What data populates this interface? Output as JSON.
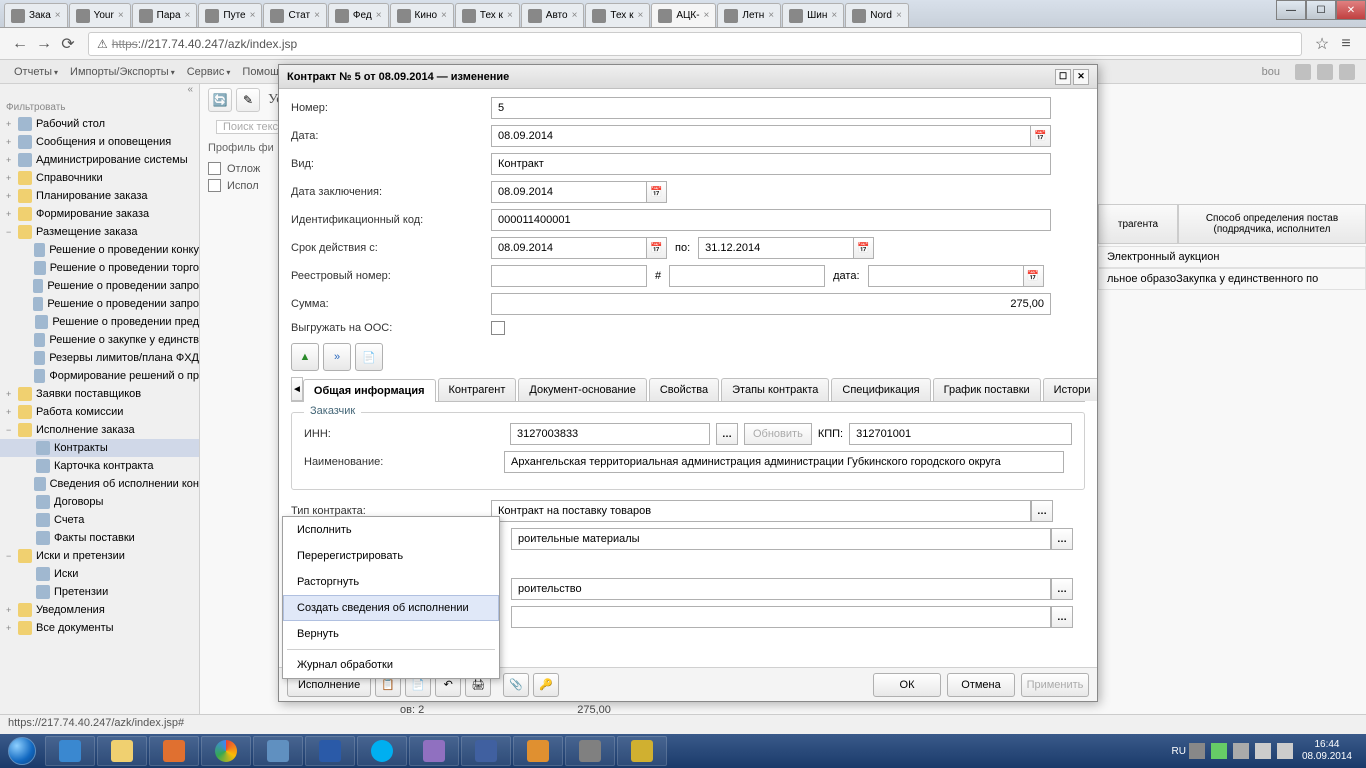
{
  "browser": {
    "tabs": [
      "Зака",
      "Your",
      "Пара",
      "Путе",
      "Стат",
      "Фед",
      "Кино",
      "Тех к",
      "Авто",
      "Тех к",
      "АЦК-",
      "Летн",
      "Шин",
      "Nord"
    ],
    "active_tab_index": 10,
    "url_proto": "https",
    "url_rest": "://217.74.40.247/azk/index.jsp"
  },
  "menubar": {
    "items": [
      "Отчеты",
      "Импорты/Экспорты",
      "Сервис",
      "Помощь"
    ],
    "user": "bou"
  },
  "sidebar": {
    "filter_label": "Фильтровать",
    "nodes": [
      {
        "icon": "file",
        "label": "Рабочий стол",
        "toggle": "+"
      },
      {
        "icon": "file",
        "label": "Сообщения и оповещения",
        "toggle": "+"
      },
      {
        "icon": "file",
        "label": "Администрирование системы",
        "toggle": "+"
      },
      {
        "icon": "folder",
        "label": "Справочники",
        "toggle": "+"
      },
      {
        "icon": "folder",
        "label": "Планирование заказа",
        "toggle": "+"
      },
      {
        "icon": "folder",
        "label": "Формирование заказа",
        "toggle": "+"
      },
      {
        "icon": "folder",
        "label": "Размещение заказа",
        "toggle": "−",
        "expanded": true
      },
      {
        "icon": "file",
        "label": "Решение о проведении конку",
        "child": true
      },
      {
        "icon": "file",
        "label": "Решение о проведении торго",
        "child": true
      },
      {
        "icon": "file",
        "label": "Решение о проведении запро",
        "child": true
      },
      {
        "icon": "file",
        "label": "Решение о проведении запро",
        "child": true
      },
      {
        "icon": "file",
        "label": "Решение о проведении пред",
        "child": true
      },
      {
        "icon": "file",
        "label": "Решение о закупке у единств",
        "child": true
      },
      {
        "icon": "file",
        "label": "Резервы лимитов/плана ФХД",
        "child": true
      },
      {
        "icon": "file",
        "label": "Формирование решений о пр",
        "child": true
      },
      {
        "icon": "folder",
        "label": "Заявки поставщиков",
        "toggle": "+"
      },
      {
        "icon": "folder",
        "label": "Работа комиссии",
        "toggle": "+"
      },
      {
        "icon": "folder",
        "label": "Исполнение заказа",
        "toggle": "−",
        "expanded": true
      },
      {
        "icon": "file",
        "label": "Контракты",
        "child": true,
        "selected": true
      },
      {
        "icon": "file",
        "label": "Карточка контракта",
        "child": true
      },
      {
        "icon": "file",
        "label": "Сведения об исполнении кон",
        "child": true
      },
      {
        "icon": "file",
        "label": "Договоры",
        "child": true
      },
      {
        "icon": "file",
        "label": "Счета",
        "child": true
      },
      {
        "icon": "file",
        "label": "Факты поставки",
        "child": true
      },
      {
        "icon": "folder",
        "label": "Иски и претензии",
        "toggle": "−",
        "expanded": true
      },
      {
        "icon": "file",
        "label": "Иски",
        "child": true
      },
      {
        "icon": "file",
        "label": "Претензии",
        "child": true
      },
      {
        "icon": "folder",
        "label": "Уведомления",
        "toggle": "+"
      },
      {
        "icon": "folder",
        "label": "Все документы",
        "toggle": "+"
      }
    ]
  },
  "main": {
    "heading": "Установл",
    "search_label": "Поиск текс",
    "profile_label": "Профиль фи",
    "filter_rows": [
      "Отлож",
      "Испол"
    ],
    "grid_headers": [
      "трагента",
      "Способ определения постав (подрядчика, исполнител"
    ],
    "grid_rows": [
      "Электронный аукцион",
      "льное образоЗакупка у единственного по"
    ],
    "footer_count_label": "ов: 2",
    "footer_sum": "275,00"
  },
  "modal": {
    "title": "Контракт № 5 от 08.09.2014 — изменение",
    "fields": {
      "number_label": "Номер:",
      "number": "5",
      "date_label": "Дата:",
      "date": "08.09.2014",
      "type_label": "Вид:",
      "type": "Контракт",
      "concl_label": "Дата заключения:",
      "concl_date": "08.09.2014",
      "ident_label": "Идентификационный код:",
      "ident": "000011400001",
      "period_label": "Срок действия с:",
      "period_from": "08.09.2014",
      "period_to_label": "по:",
      "period_to": "31.12.2014",
      "registry_label": "Реестровый номер:",
      "hash_label": "#",
      "date_small_label": "дата:",
      "sum_label": "Сумма:",
      "sum": "275,00",
      "oos_label": "Выгружать на ООС:"
    },
    "tabs": [
      "Общая информация",
      "Контрагент",
      "Документ-основание",
      "Свойства",
      "Этапы контракта",
      "Спецификация",
      "График поставки",
      "Истори"
    ],
    "active_tab": 0,
    "customer": {
      "legend": "Заказчик",
      "inn_label": "ИНН:",
      "inn": "3127003833",
      "update_btn": "Обновить",
      "kpp_label": "КПП:",
      "kpp": "312701001",
      "name_label": "Наименование:",
      "name": "Архангельская территориальная администрация администрации Губкинского городского округа"
    },
    "contract_type_label": "Тип контракта:",
    "contract_type": "Контракт на поставку товаров",
    "row2": "роительные материалы",
    "row3": "роительство",
    "btn_status": "Исполнение",
    "ok": "ОК",
    "cancel": "Отмена",
    "apply": "Применить"
  },
  "context_menu": {
    "items": [
      "Исполнить",
      "Перерегистрировать",
      "Расторгнуть",
      "Создать сведения об исполнении",
      "Вернуть",
      "Журнал обработки"
    ],
    "hover_index": 3
  },
  "status_bar": "https://217.74.40.247/azk/index.jsp#",
  "taskbar": {
    "lang": "RU",
    "time": "16:44",
    "date": "08.09.2014"
  }
}
